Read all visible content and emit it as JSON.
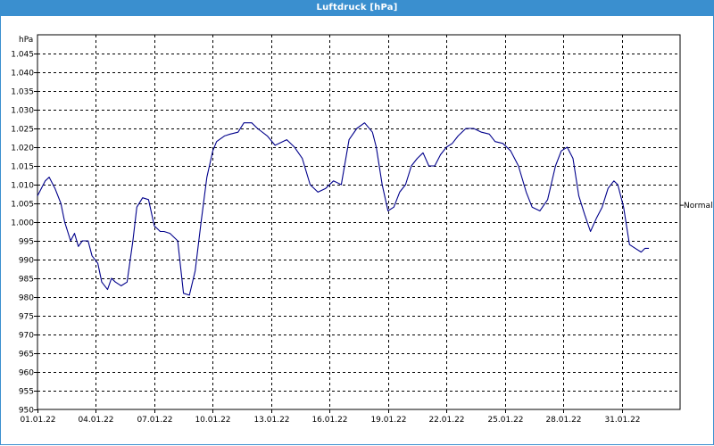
{
  "window": {
    "title": "Luftdruck [hPa]"
  },
  "chart_data": {
    "type": "line",
    "title": "Luftdruck [hPa]",
    "ylabel": "hPa",
    "xlabel": "",
    "ylim": [
      950,
      1050
    ],
    "xlim": [
      0,
      33
    ],
    "grid": true,
    "y_ticks": [
      950,
      955,
      960,
      965,
      970,
      975,
      980,
      985,
      990,
      995,
      1000,
      1005,
      1010,
      1015,
      1020,
      1025,
      1030,
      1035,
      1040,
      1045
    ],
    "y_tick_labels": [
      "950",
      "955",
      "960",
      "965",
      "970",
      "975",
      "980",
      "985",
      "990",
      "995",
      "1.000",
      "1.005",
      "1.010",
      "1.015",
      "1.020",
      "1.025",
      "1.030",
      "1.035",
      "1.040",
      "1.045"
    ],
    "x_ticks": [
      0,
      3,
      6,
      9,
      12,
      15,
      18,
      21,
      24,
      27,
      30
    ],
    "x_tick_labels": [
      "01.01.22",
      "04.01.22",
      "07.01.22",
      "10.01.22",
      "13.01.22",
      "16.01.22",
      "19.01.22",
      "22.01.22",
      "25.01.22",
      "28.01.22",
      "31.01.22"
    ],
    "reference_line": {
      "label": "Normal",
      "value": 1004.5
    },
    "series": [
      {
        "color": "#00008b",
        "x": [
          0,
          0.4,
          0.6,
          0.9,
          1.2,
          1.4,
          1.7,
          1.9,
          2.1,
          2.3,
          2.6,
          2.8,
          3.1,
          3.3,
          3.6,
          3.8,
          4.0,
          4.3,
          4.6,
          4.9,
          5.1,
          5.4,
          5.7,
          6.0,
          6.3,
          6.5,
          6.8,
          7.2,
          7.5,
          7.8,
          8.1,
          8.4,
          8.7,
          9.0,
          9.2,
          9.6,
          9.9,
          10.3,
          10.6,
          11.0,
          11.3,
          11.8,
          12.2,
          12.8,
          13.2,
          13.6,
          14.0,
          14.4,
          14.8,
          15.2,
          15.6,
          16.0,
          16.4,
          16.8,
          17.2,
          17.4,
          17.7,
          18.0,
          18.3,
          18.6,
          18.9,
          19.2,
          19.5,
          19.8,
          20.1,
          20.4,
          20.7,
          21.0,
          21.3,
          21.6,
          22.0,
          22.4,
          22.8,
          23.2,
          23.5,
          23.9,
          24.3,
          24.7,
          25.1,
          25.4,
          25.8,
          26.2,
          26.6,
          26.9,
          27.2,
          27.5,
          27.8,
          28.1,
          28.4,
          28.7,
          29.0,
          29.3,
          29.6,
          29.8,
          30.1,
          30.4,
          30.7,
          31.0,
          31.2,
          31.4
        ],
        "y": [
          1007.0,
          1011.0,
          1012.0,
          1009.0,
          1005.0,
          1000.0,
          995.0,
          997.0,
          993.5,
          995.0,
          995.0,
          991.0,
          989.0,
          984.0,
          982.0,
          985.0,
          984.0,
          983.0,
          984.0,
          995.0,
          1004.0,
          1006.5,
          1006.0,
          999.0,
          997.5,
          997.5,
          997.0,
          995.0,
          981.0,
          980.5,
          987.0,
          1000.0,
          1012.0,
          1019.0,
          1021.5,
          1023.0,
          1023.5,
          1024.0,
          1026.5,
          1026.5,
          1025.0,
          1023.0,
          1020.5,
          1022.0,
          1020.0,
          1017.0,
          1010.0,
          1008.0,
          1009.0,
          1011.0,
          1010.0,
          1022.0,
          1025.0,
          1026.5,
          1024.0,
          1020.0,
          1010.0,
          1003.0,
          1004.0,
          1008.0,
          1010.0,
          1015.0,
          1017.0,
          1018.5,
          1015.0,
          1015.0,
          1018.0,
          1020.0,
          1021.0,
          1023.0,
          1025.0,
          1025.0,
          1024.0,
          1023.5,
          1021.5,
          1021.0,
          1019.0,
          1015.0,
          1008.0,
          1004.0,
          1003.0,
          1006.0,
          1015.0,
          1019.0,
          1020.0,
          1017.0,
          1007.0,
          1002.0,
          997.5,
          1001.0,
          1004.0,
          1009.0,
          1011.0,
          1010.0,
          1004.0,
          994.0,
          993.0,
          992.0,
          993.0,
          993.0
        ]
      }
    ]
  }
}
